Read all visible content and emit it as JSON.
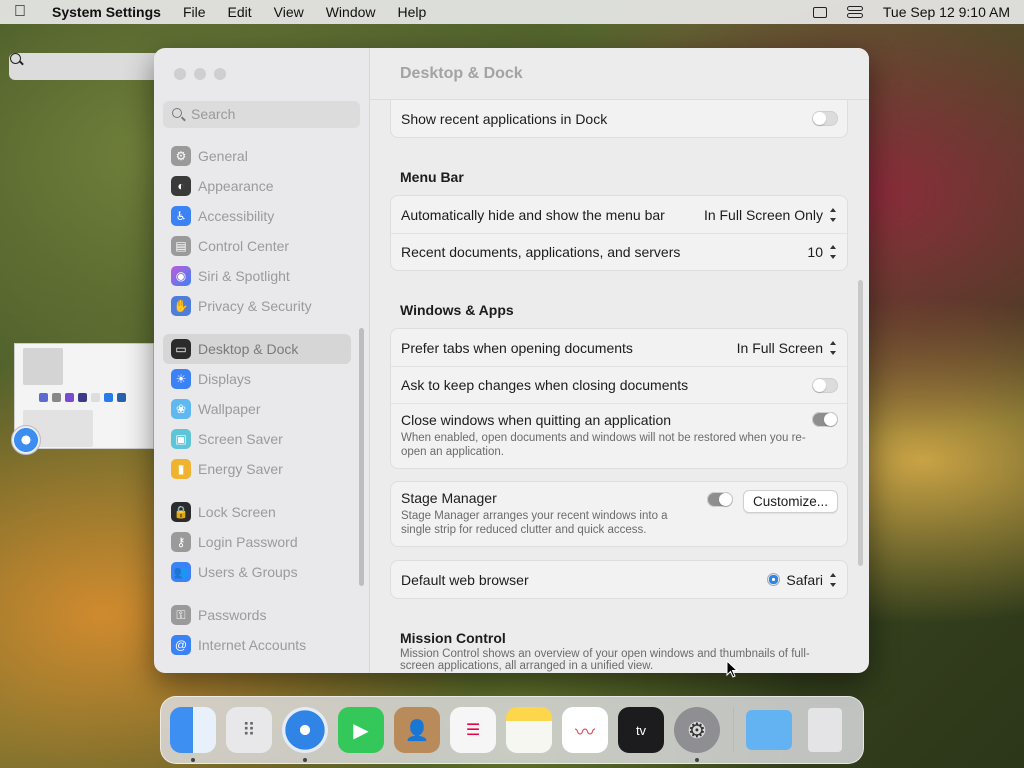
{
  "menubar": {
    "app_name": "System Settings",
    "menus": [
      "File",
      "Edit",
      "View",
      "Window",
      "Help"
    ],
    "datetime": "Tue Sep 12  9:10 AM"
  },
  "window": {
    "title": "Desktop & Dock"
  },
  "sidebar": {
    "search_placeholder": "Search",
    "items": [
      {
        "label": "General",
        "icon": "gear-icon",
        "color": "#9a9a9a"
      },
      {
        "label": "Appearance",
        "icon": "appearance-icon",
        "color": "#3a3a3a"
      },
      {
        "label": "Accessibility",
        "icon": "accessibility-icon",
        "color": "#3b82f6"
      },
      {
        "label": "Control Center",
        "icon": "control-center-icon",
        "color": "#9a9a9a"
      },
      {
        "label": "Siri & Spotlight",
        "icon": "siri-icon",
        "color": "#c25bd9"
      },
      {
        "label": "Privacy & Security",
        "icon": "hand-icon",
        "color": "#4f7ddb"
      },
      {
        "label": "Desktop & Dock",
        "icon": "dock-icon",
        "color": "#2b2b2b"
      },
      {
        "label": "Displays",
        "icon": "displays-icon",
        "color": "#3b82f6"
      },
      {
        "label": "Wallpaper",
        "icon": "wallpaper-icon",
        "color": "#5fb8f0"
      },
      {
        "label": "Screen Saver",
        "icon": "screen-saver-icon",
        "color": "#5ec5d8"
      },
      {
        "label": "Energy Saver",
        "icon": "battery-icon",
        "color": "#f0b330"
      },
      {
        "label": "Lock Screen",
        "icon": "lock-icon",
        "color": "#2b2b2b"
      },
      {
        "label": "Login Password",
        "icon": "key-icon",
        "color": "#9a9a9a"
      },
      {
        "label": "Users & Groups",
        "icon": "users-icon",
        "color": "#3b82f6"
      },
      {
        "label": "Passwords",
        "icon": "passwords-key-icon",
        "color": "#9a9a9a"
      },
      {
        "label": "Internet Accounts",
        "icon": "at-icon",
        "color": "#3b82f6"
      }
    ],
    "selected": "Desktop & Dock"
  },
  "content": {
    "dock_row": {
      "label": "Show recent applications in Dock",
      "toggle": false
    },
    "menu_bar": {
      "title": "Menu Bar",
      "rows": [
        {
          "label": "Automatically hide and show the menu bar",
          "value": "In Full Screen Only"
        },
        {
          "label": "Recent documents, applications, and servers",
          "value": "10"
        }
      ]
    },
    "windows_apps": {
      "title": "Windows & Apps",
      "prefer_tabs": {
        "label": "Prefer tabs when opening documents",
        "value": "In Full Screen"
      },
      "ask_keep": {
        "label": "Ask to keep changes when closing documents",
        "toggle": false
      },
      "close_windows": {
        "label": "Close windows when quitting an application",
        "description": "When enabled, open documents and windows will not be restored when you re-open an application.",
        "toggle": true
      },
      "stage_manager": {
        "label": "Stage Manager",
        "description": "Stage Manager arranges your recent windows into a single strip for reduced clutter and quick access.",
        "toggle": true,
        "button": "Customize..."
      },
      "browser": {
        "label": "Default web browser",
        "value": "Safari"
      }
    },
    "mission_control": {
      "title": "Mission Control",
      "description": "Mission Control shows an overview of your open windows and thumbnails of full-screen applications, all arranged in a unified view."
    }
  },
  "dock": {
    "apps": [
      {
        "name": "finder-icon",
        "color": "#3d8ff2",
        "running": true
      },
      {
        "name": "launchpad-icon",
        "color": "#e8e8ea",
        "running": false
      },
      {
        "name": "safari-icon",
        "color": "#2f84e6",
        "running": true
      },
      {
        "name": "facetime-icon",
        "color": "#34c759",
        "running": false
      },
      {
        "name": "contacts-icon",
        "color": "#b98a5a",
        "running": false
      },
      {
        "name": "reminders-icon",
        "color": "#f6f6f6",
        "running": false
      },
      {
        "name": "notes-icon",
        "color": "#fdd64b",
        "running": false
      },
      {
        "name": "freeform-icon",
        "color": "#ffffff",
        "running": false
      },
      {
        "name": "apple-tv-icon",
        "color": "#1c1c1e",
        "running": false
      },
      {
        "name": "system-settings-icon",
        "color": "#8e8e93",
        "running": true
      }
    ],
    "folders": [
      {
        "name": "downloads-folder-icon",
        "color": "#63b3f2"
      },
      {
        "name": "trash-icon",
        "color": "#e4e4e6"
      }
    ]
  }
}
